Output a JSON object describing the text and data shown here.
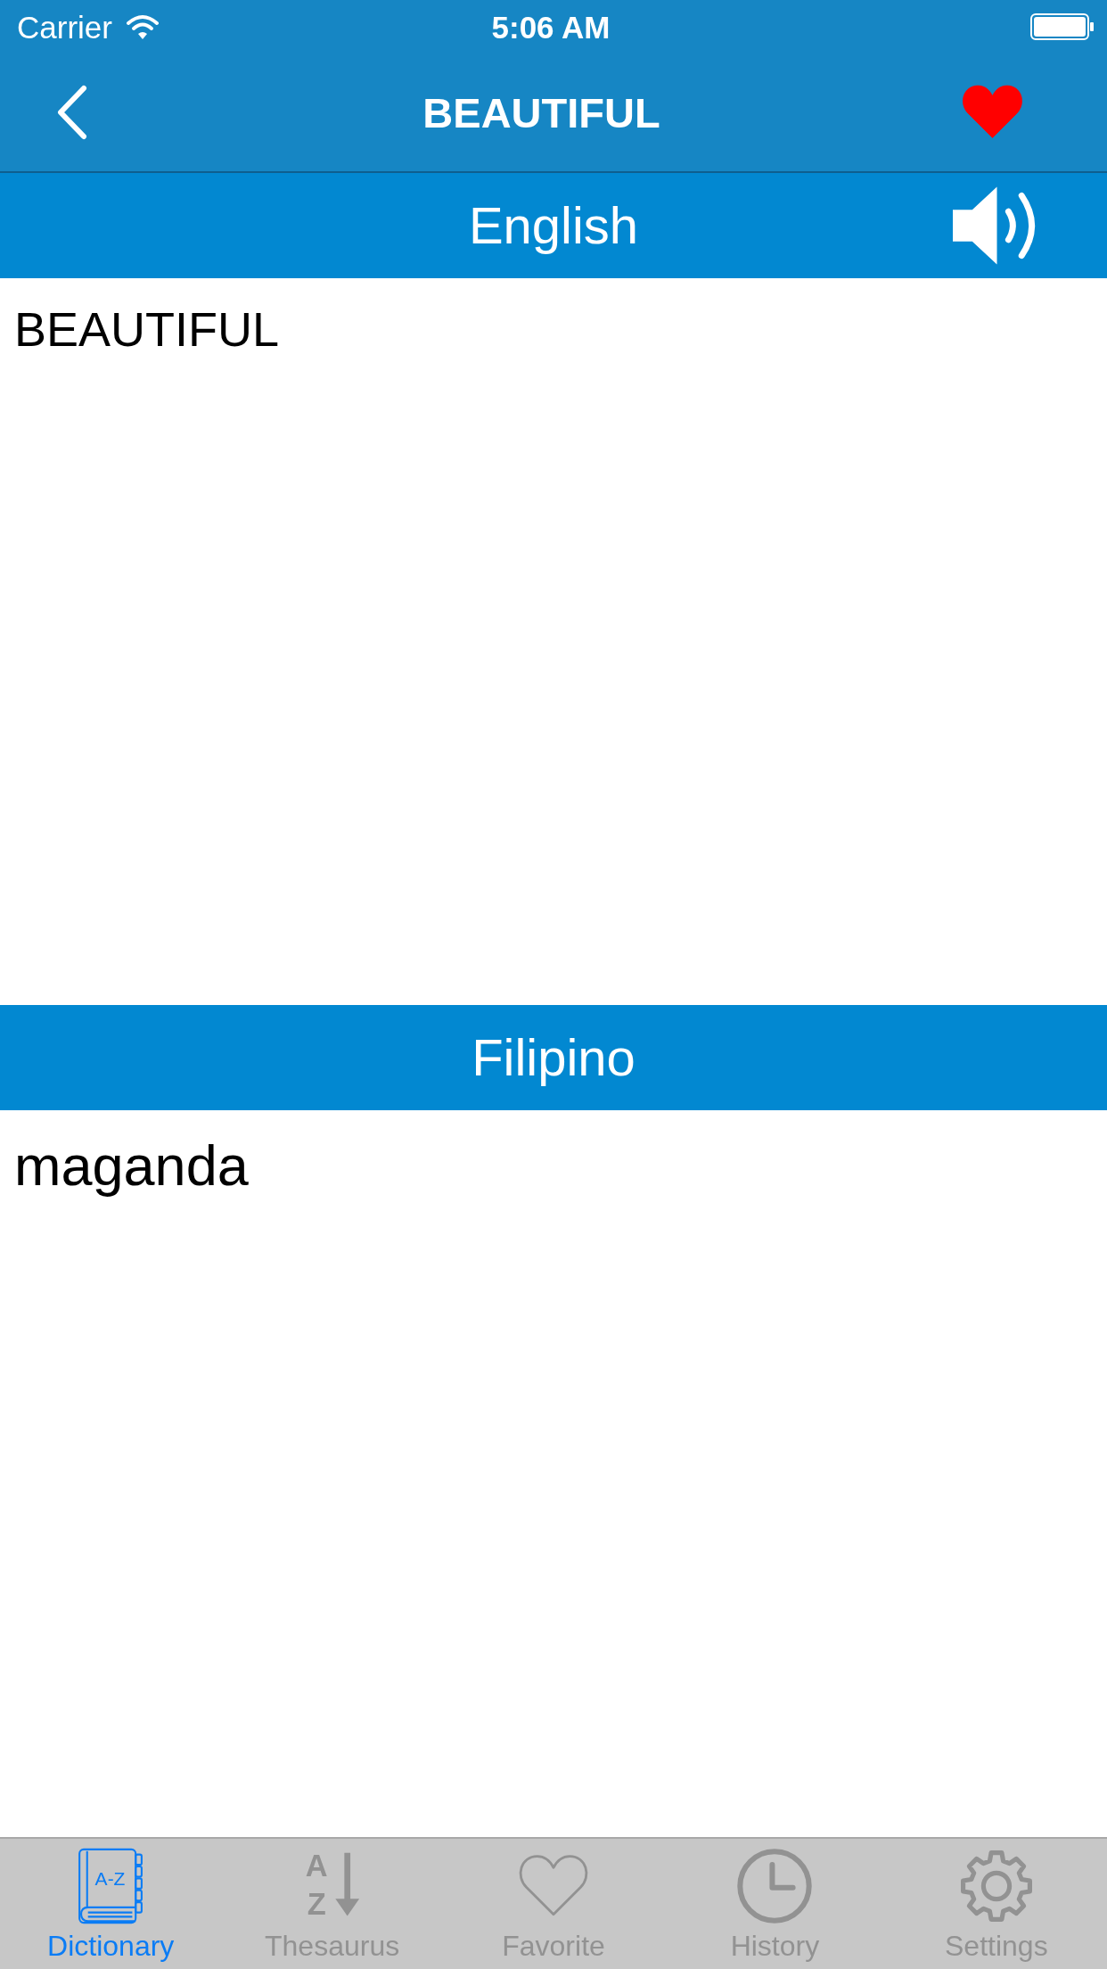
{
  "status_bar": {
    "carrier": "Carrier",
    "time": "5:06 AM"
  },
  "nav_bar": {
    "title": "BEAUTIFUL",
    "favorite": true
  },
  "sections": [
    {
      "language": "English",
      "speaker": true,
      "text": "BEAUTIFUL"
    },
    {
      "language": "Filipino",
      "speaker": false,
      "text": "maganda"
    }
  ],
  "tab_bar": {
    "items": [
      {
        "kind": "dictionary",
        "icon_text": "A-Z",
        "label": "Dictionary",
        "selected": true
      },
      {
        "kind": "thesaurus",
        "icon_letters": [
          "A",
          "Z"
        ],
        "label": "Thesaurus",
        "selected": false
      },
      {
        "kind": "favorite",
        "label": "Favorite",
        "selected": false
      },
      {
        "kind": "history",
        "label": "History",
        "selected": false
      },
      {
        "kind": "settings",
        "label": "Settings",
        "selected": false
      }
    ]
  }
}
